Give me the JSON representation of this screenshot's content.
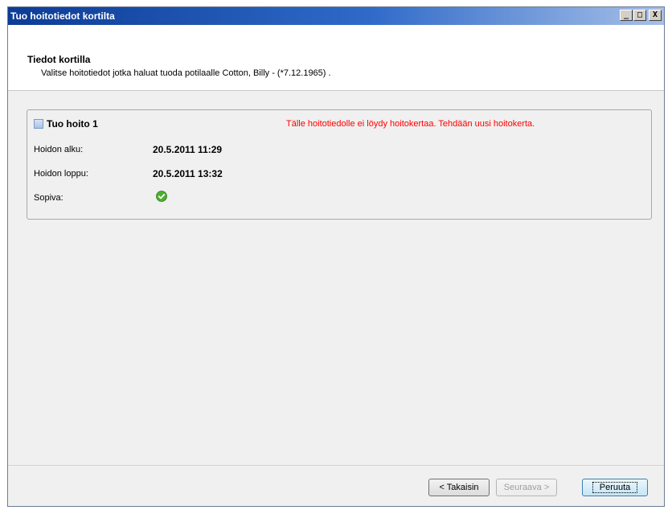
{
  "window": {
    "title": "Tuo hoitotiedot kortilta",
    "buttons": {
      "minimize": "_",
      "maximize": "□",
      "close": "X"
    }
  },
  "header": {
    "title": "Tiedot kortilla",
    "subtitle": "Valitse hoitotiedot jotka haluat tuoda potilaalle Cotton, Billy - (*7.12.1965) ."
  },
  "group": {
    "title": "Tuo hoito 1",
    "warning": "Tälle hoitotiedolle ei löydy hoitokertaa. Tehdään uusi hoitokerta.",
    "warning_color": "#ff0000",
    "fields": [
      {
        "label": "Hoidon alku:",
        "value": "20.5.2011 11:29"
      },
      {
        "label": "Hoidon loppu:",
        "value": "20.5.2011 13:32"
      },
      {
        "label": "Sopiva:",
        "icon": "check-ok-icon",
        "icon_color": "#4caf2f"
      }
    ]
  },
  "footer": {
    "back": "< Takaisin",
    "next": "Seuraava >",
    "cancel": "Peruuta"
  }
}
